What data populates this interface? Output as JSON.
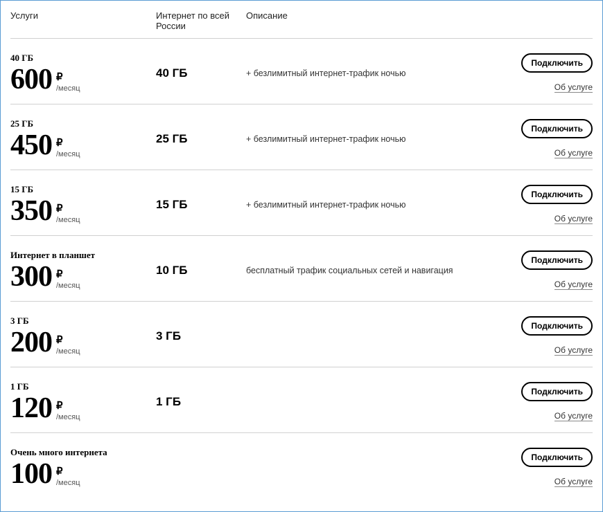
{
  "headers": {
    "service": "Услуги",
    "data": "Интернет по всей России",
    "desc": "Описание"
  },
  "common": {
    "currency": "₽",
    "per": "/месяц",
    "connect": "Подключить",
    "about": "Об услуге"
  },
  "rows": [
    {
      "title": "40 ГБ",
      "price": "600",
      "data": "40 ГБ",
      "desc": "+ безлимитный интернет-трафик ночью"
    },
    {
      "title": "25 ГБ",
      "price": "450",
      "data": "25 ГБ",
      "desc": "+ безлимитный интернет-трафик ночью"
    },
    {
      "title": "15 ГБ",
      "price": "350",
      "data": "15 ГБ",
      "desc": "+ безлимитный интернет-трафик ночью"
    },
    {
      "title": "Интернет в планшет",
      "price": "300",
      "data": "10 ГБ",
      "desc": "бесплатный трафик социальных сетей и навигация"
    },
    {
      "title": "3 ГБ",
      "price": "200",
      "data": "3 ГБ",
      "desc": ""
    },
    {
      "title": "1 ГБ",
      "price": "120",
      "data": "1 ГБ",
      "desc": ""
    },
    {
      "title": "Очень много интернета",
      "price": "100",
      "data": "",
      "desc": ""
    }
  ]
}
